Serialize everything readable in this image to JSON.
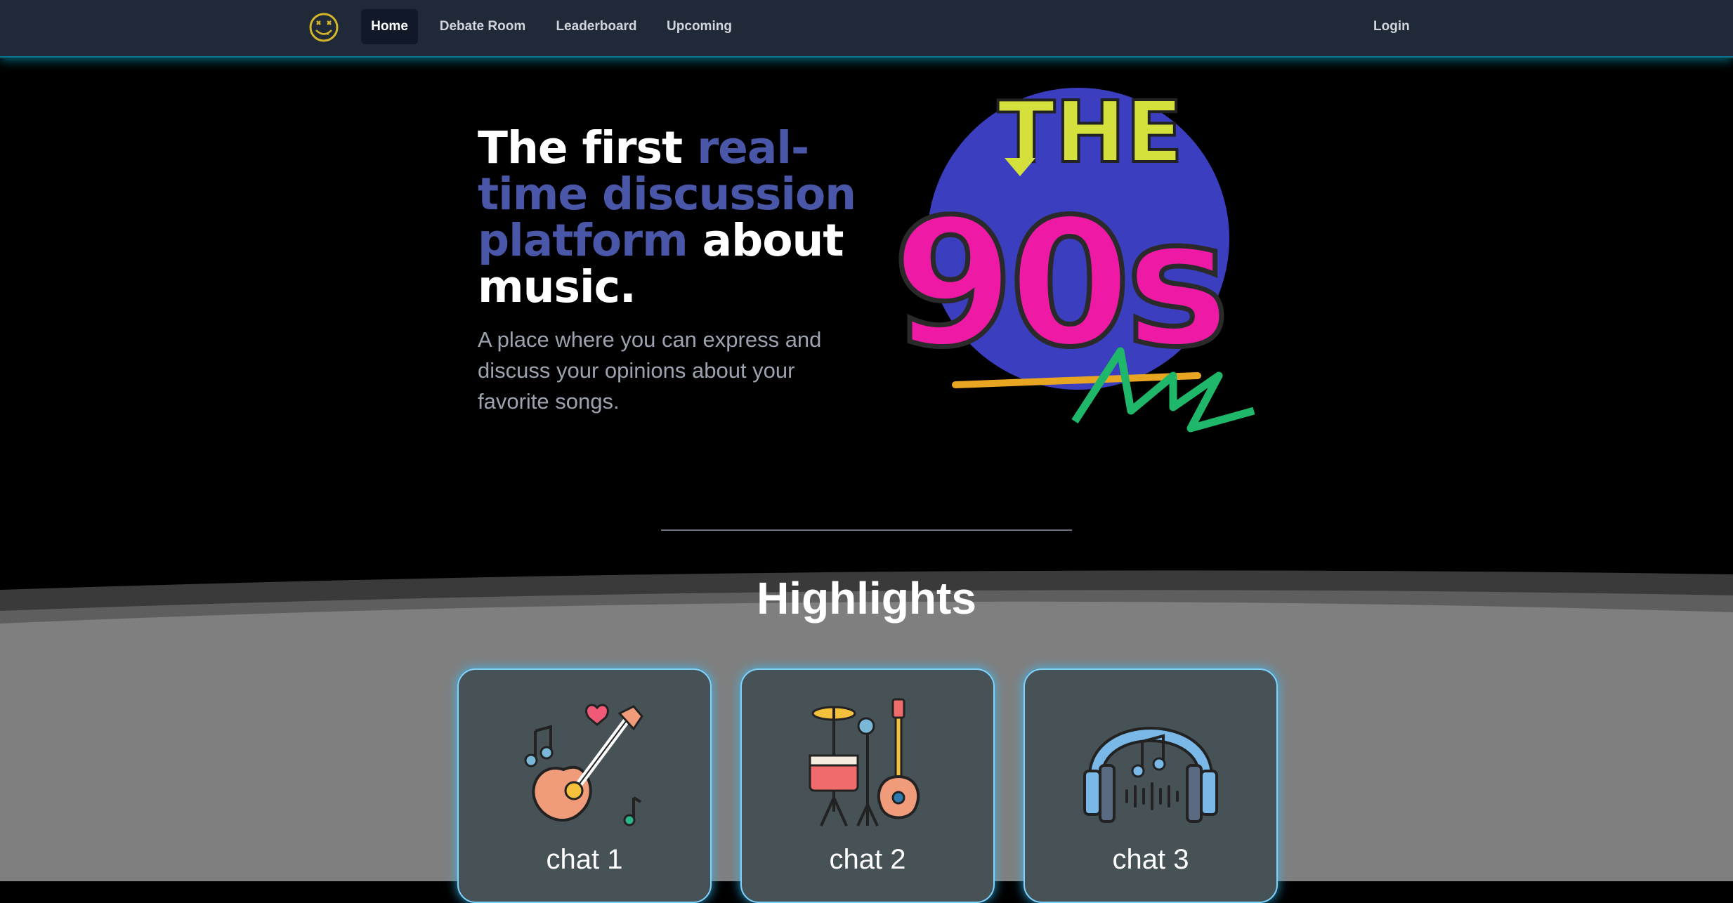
{
  "nav": {
    "items": [
      {
        "label": "Home",
        "active": true
      },
      {
        "label": "Debate Room",
        "active": false
      },
      {
        "label": "Leaderboard",
        "active": false
      },
      {
        "label": "Upcoming",
        "active": false
      }
    ],
    "login_label": "Login",
    "logo_icon": "smiley-face-icon"
  },
  "hero": {
    "title_part1": "The first ",
    "title_accent": "real-time discussion platform",
    "title_part2": " about music.",
    "subtitle": "A place where you can express and discuss your opinions about your favorite songs.",
    "art_text_top": "THE",
    "art_text_main": "90s"
  },
  "highlights": {
    "title": "Highlights",
    "cards": [
      {
        "label": "chat 1",
        "icon": "guitar-icon"
      },
      {
        "label": "chat 2",
        "icon": "drums-guitar-icon"
      },
      {
        "label": "chat 3",
        "icon": "headphones-icon"
      }
    ]
  },
  "colors": {
    "nav_bg": "#1f2937",
    "accent_text": "#4a57a8",
    "card_bg": "#475257",
    "card_glow": "#38bdf8"
  }
}
